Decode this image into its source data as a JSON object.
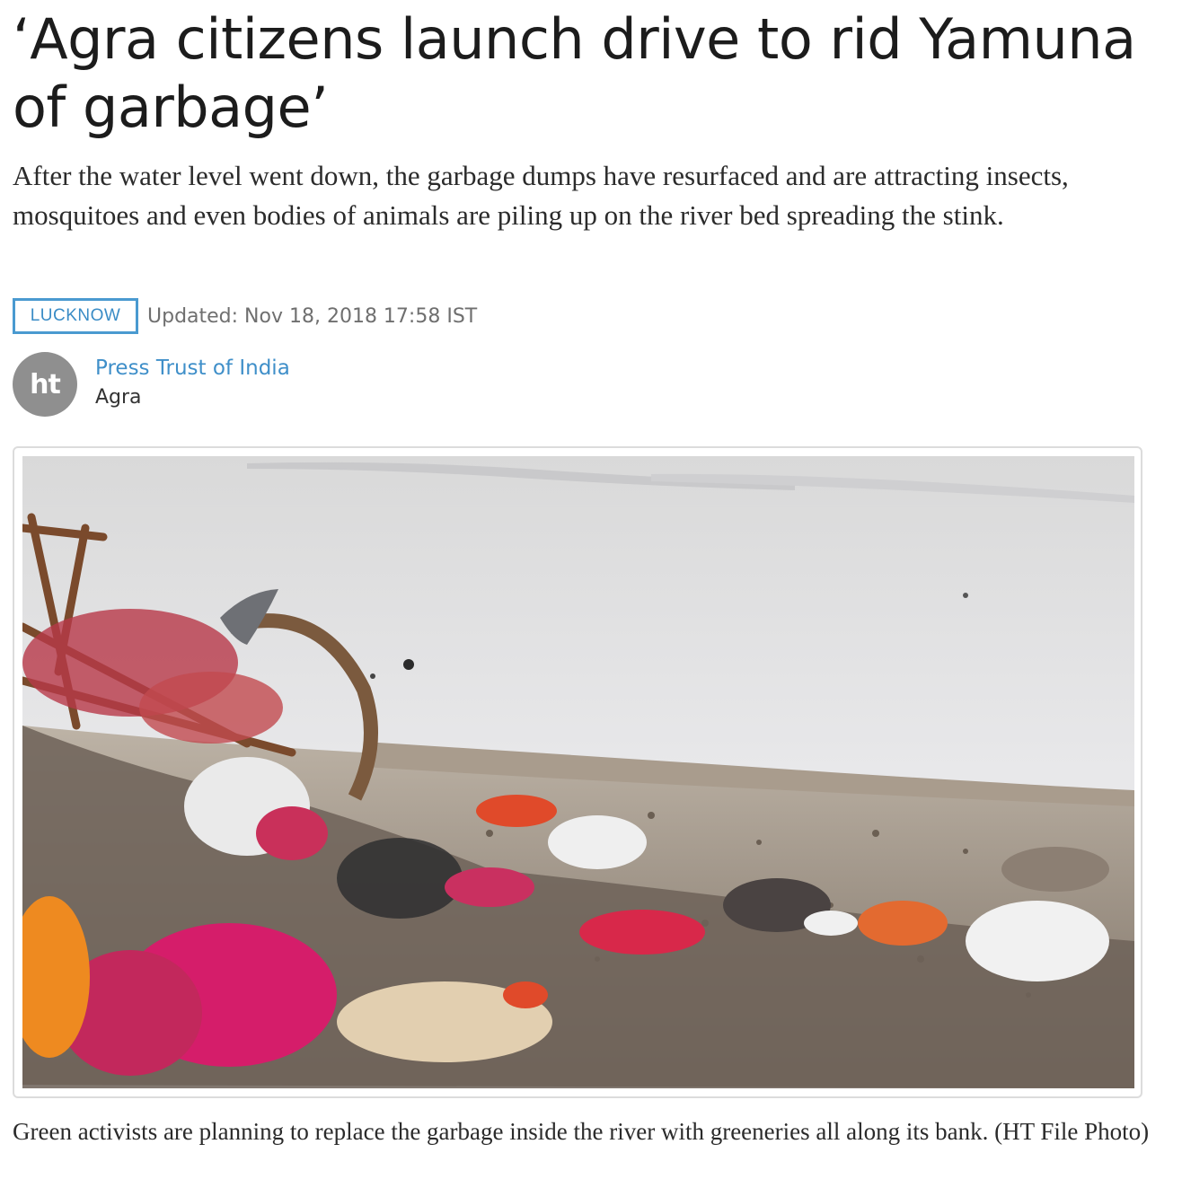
{
  "article": {
    "headline": "‘Agra citizens launch drive to rid Yamuna of garbage’",
    "summary": "After the water level went down, the garbage dumps have resurfaced and are attracting insects, mosquitoes and even bodies of animals are piling up on the river bed spreading the stink.",
    "section": "LUCKNOW",
    "updated": "Updated: Nov 18, 2018 17:58 IST",
    "author": {
      "avatar_text": "ht",
      "name": "Press Trust of India",
      "location": "Agra"
    },
    "figure": {
      "caption": "Green activists are planning to replace the garbage inside the river with greeneries all along its bank. (HT File Photo)"
    }
  },
  "colors": {
    "accent": "#3f8fc9",
    "badge_border": "#4a9ad0",
    "avatar_bg": "#8f8f8f"
  }
}
